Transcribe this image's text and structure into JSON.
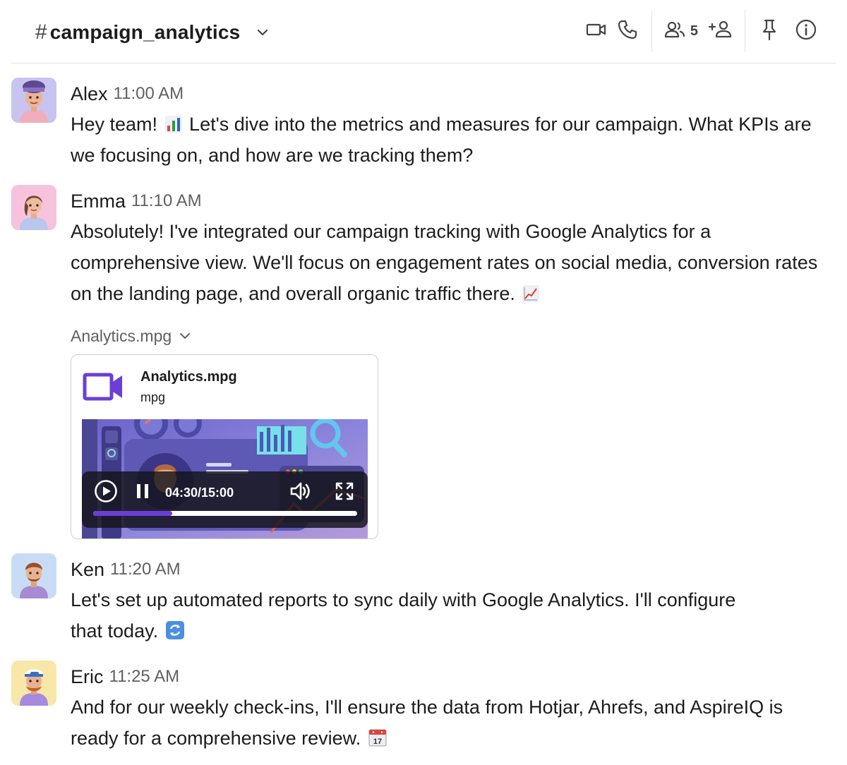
{
  "header": {
    "hash": "#",
    "channel_name": "campaign_analytics",
    "member_count": "5"
  },
  "icons": {
    "channel_menu": "chevron-down-icon",
    "video_call": "video-camera-icon",
    "audio_call": "phone-icon",
    "members": "people-icon",
    "add_member": "add-person-icon",
    "pin": "pin-icon",
    "info": "info-icon"
  },
  "colors": {
    "accent": "#6b3fd4",
    "timestamp": "#616061",
    "divider": "#e3e3e3"
  },
  "messages": [
    {
      "author": "Alex",
      "time": "11:00 AM",
      "text_a": "Hey team! ",
      "emoji": "bar-chart-emoji",
      "text_b": " Let's dive into the metrics and measures for our campaign. What KPIs are we focusing on, and how are we tracking them?"
    },
    {
      "author": "Emma",
      "time": "11:10 AM",
      "text": "Absolutely! I've integrated our campaign tracking with Google Analytics for a comprehensive view. We'll focus on engagement rates on social media, conversion rates on the landing page, and overall organic traffic there.",
      "emoji": "chart-increasing-emoji"
    },
    {
      "author": "Ken",
      "time": "11:20 AM",
      "text": "Let's set up automated reports to sync daily with Google Analytics. I'll configure that today.",
      "emoji": "arrows-counterclockwise-emoji"
    },
    {
      "author": "Eric",
      "time": "11:25 AM",
      "text": "And for our weekly check-ins, I'll ensure the data from Hotjar, Ahrefs, and AspireIQ is ready for a comprehensive review.",
      "emoji": "calendar-emoji"
    }
  ],
  "attachment": {
    "toggle_label": "Analytics.mpg",
    "file_name": "Analytics.mpg",
    "file_type": "mpg",
    "player": {
      "time": "04:30/15:00",
      "progress_fraction": 0.3,
      "state": "playing"
    }
  }
}
